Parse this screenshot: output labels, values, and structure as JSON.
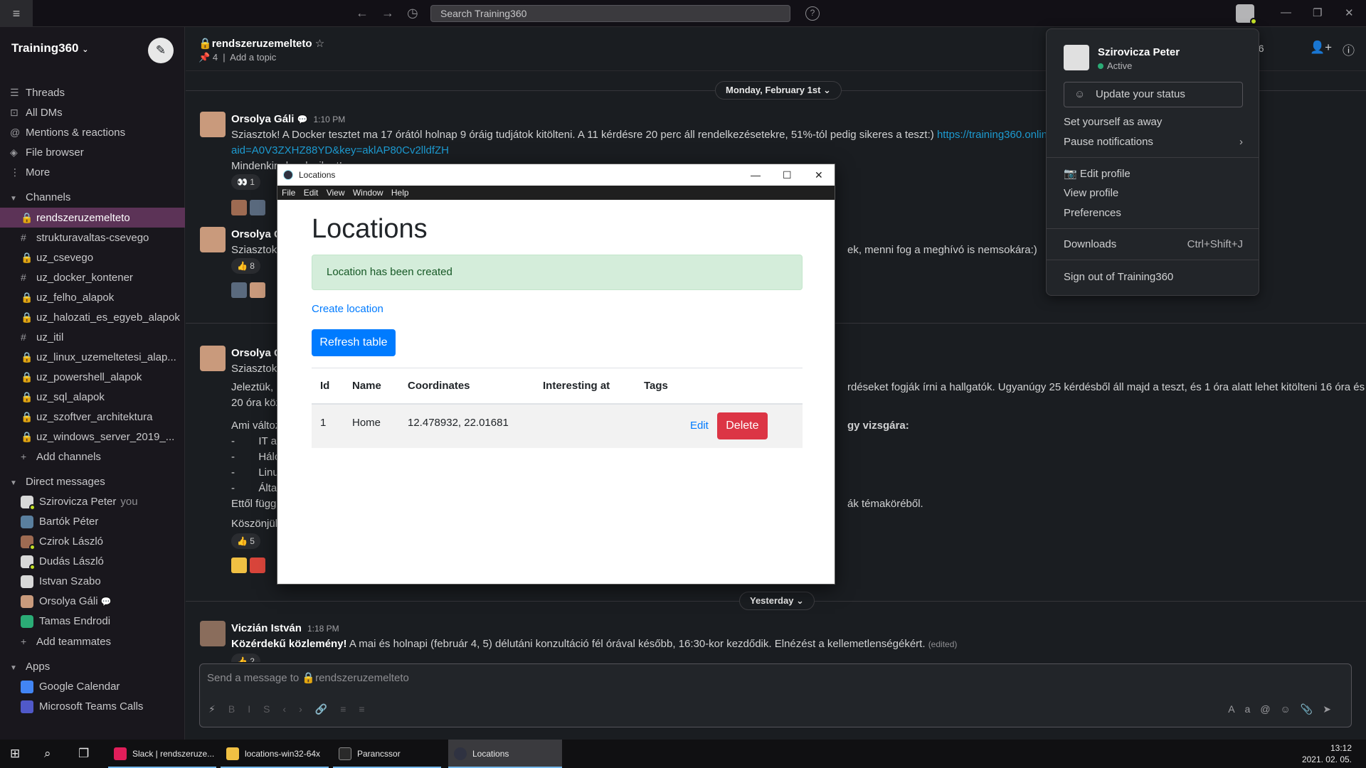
{
  "topbar": {
    "search_placeholder": "Search Training360"
  },
  "sidebar": {
    "workspace": "Training360",
    "nav": [
      {
        "icon": "threads-icon",
        "label": "Threads"
      },
      {
        "icon": "dms-icon",
        "label": "All DMs"
      },
      {
        "icon": "at-icon",
        "label": "Mentions & reactions"
      },
      {
        "icon": "layers-icon",
        "label": "File browser"
      },
      {
        "icon": "more-icon",
        "label": "More"
      }
    ],
    "channels_header": "Channels",
    "channels": [
      {
        "name": "rendszeruzemelteto",
        "private": true,
        "active": true
      },
      {
        "name": "strukturavaltas-csevego",
        "private": false
      },
      {
        "name": "uz_csevego",
        "private": true
      },
      {
        "name": "uz_docker_kontener",
        "private": false
      },
      {
        "name": "uz_felho_alapok",
        "private": true
      },
      {
        "name": "uz_halozati_es_egyeb_alapok",
        "private": true
      },
      {
        "name": "uz_itil",
        "private": false
      },
      {
        "name": "uz_linux_uzemeltetesi_alap...",
        "private": true
      },
      {
        "name": "uz_powershell_alapok",
        "private": true
      },
      {
        "name": "uz_sql_alapok",
        "private": true
      },
      {
        "name": "uz_szoftver_architektura",
        "private": true
      },
      {
        "name": "uz_windows_server_2019_...",
        "private": true
      }
    ],
    "add_channels": "Add channels",
    "dm_header": "Direct messages",
    "dms": [
      {
        "name": "Szirovicza Peter",
        "you": "you",
        "color": "#d8d8d8"
      },
      {
        "name": "Bartók Péter",
        "you": "",
        "color": "#5a7f9e"
      },
      {
        "name": "Czirok László",
        "you": "",
        "color": "#9e6b52"
      },
      {
        "name": "Dudás László",
        "you": "",
        "color": "#d8d8d8"
      },
      {
        "name": "Istvan Szabo",
        "you": "",
        "color": "#d8d8d8"
      },
      {
        "name": "Orsolya Gáli",
        "you": "",
        "color": "#c99a7c"
      },
      {
        "name": "Tamas Endrodi",
        "you": "",
        "color": "#2bac76"
      }
    ],
    "add_teammates": "Add teammates",
    "apps_header": "Apps",
    "apps": [
      {
        "name": "Google Calendar",
        "color": "#4285f4"
      },
      {
        "name": "Microsoft Teams Calls",
        "color": "#5059c9"
      }
    ]
  },
  "channel": {
    "name": "rendszeruzemelteto",
    "pins": "4",
    "topic": "Add a topic",
    "member_count": "96"
  },
  "messages": {
    "date1": "Monday, February 1st",
    "date2": "Yesterday",
    "m1": {
      "author": "Orsolya Gáli",
      "time": "1:10 PM",
      "line1": "Sziasztok! A Docker tesztet ma 17 órától holnap 9 óráig tudjátok kitölteni. A 11 kérdésre 20 perc áll rendelkezésetekre, 51%-tól pedig sikeres a teszt:)",
      "link": "https://training360.online",
      "line2": "aid=A0V3ZXHZ88YD&key=aklAP80Cv2lldfZH",
      "line3": "Mindenkinek sok sikert!",
      "reaction": "1"
    },
    "m2": {
      "author": "Orsolya G",
      "line1": "Sziasztok!",
      "line1_right": "ek, menni fog a meghívó is nemsokára:)",
      "reaction": "8"
    },
    "m3": {
      "author": "Orsolya G",
      "line1": "Sziasztok!",
      "p1_left": "Jeleztük, h",
      "p1_right": "rdéseket fogják írni a hallgatók. Ugyanúgy 25 kérdésből áll majd a teszt, és 1 óra alatt lehet kitölteni 16 óra és",
      "p1_l2": "20 óra köz",
      "p2_left": "Ami változ",
      "p2_right": "gy vizsgára:",
      "b1": "IT a",
      "b2": "Hálo",
      "b3": "Linu",
      "b4": "Álta",
      "p3_left": "Ettől függ",
      "p3_right": "ák témaköréből.",
      "p4_left": "Köszönjük",
      "reaction": "5"
    },
    "m4": {
      "author": "Viczián István",
      "time": "1:18 PM",
      "bold": "Közérdekű közlemény!",
      "text": " A mai és holnapi (február 4, 5) délutáni konzultáció fél órával később, 16:30-kor kezdődik. Elnézést a kellemetlenségékért.",
      "edited": "(edited)",
      "reaction": "2"
    }
  },
  "composer": {
    "placeholder": "Send a message to 🔒rendszeruzemelteto",
    "aa": "Aa"
  },
  "profile_menu": {
    "name": "Szirovicza Peter",
    "status": "Active",
    "update_status": "Update your status",
    "set_away": "Set yourself as away",
    "pause": "Pause notifications",
    "edit_profile": "Edit profile",
    "view_profile": "View profile",
    "preferences": "Preferences",
    "downloads": "Downloads",
    "downloads_shortcut": "Ctrl+Shift+J",
    "sign_out": "Sign out of Training360"
  },
  "app_window": {
    "title": "Locations",
    "menu": [
      "File",
      "Edit",
      "View",
      "Window",
      "Help"
    ],
    "heading": "Locations",
    "alert": "Location has been created",
    "create_link": "Create location",
    "refresh_button": "Refresh table",
    "table": {
      "headers": [
        "Id",
        "Name",
        "Coordinates",
        "Interesting at",
        "Tags"
      ],
      "rows": [
        {
          "id": "1",
          "name": "Home",
          "coordinates": "12.478932, 22.01681",
          "interesting_at": "",
          "tags": "",
          "edit": "Edit",
          "delete": "Delete"
        }
      ]
    }
  },
  "taskbar": {
    "apps": [
      {
        "label": "Slack | rendszeruze...",
        "color": "#e01e5a"
      },
      {
        "label": "locations-win32-64x",
        "color": "#f0c043"
      },
      {
        "label": "Parancssor",
        "color": "#2a2a2a"
      },
      {
        "label": "Locations",
        "color": "#2f3241"
      }
    ],
    "time": "13:12",
    "date": "2021. 02. 05."
  }
}
